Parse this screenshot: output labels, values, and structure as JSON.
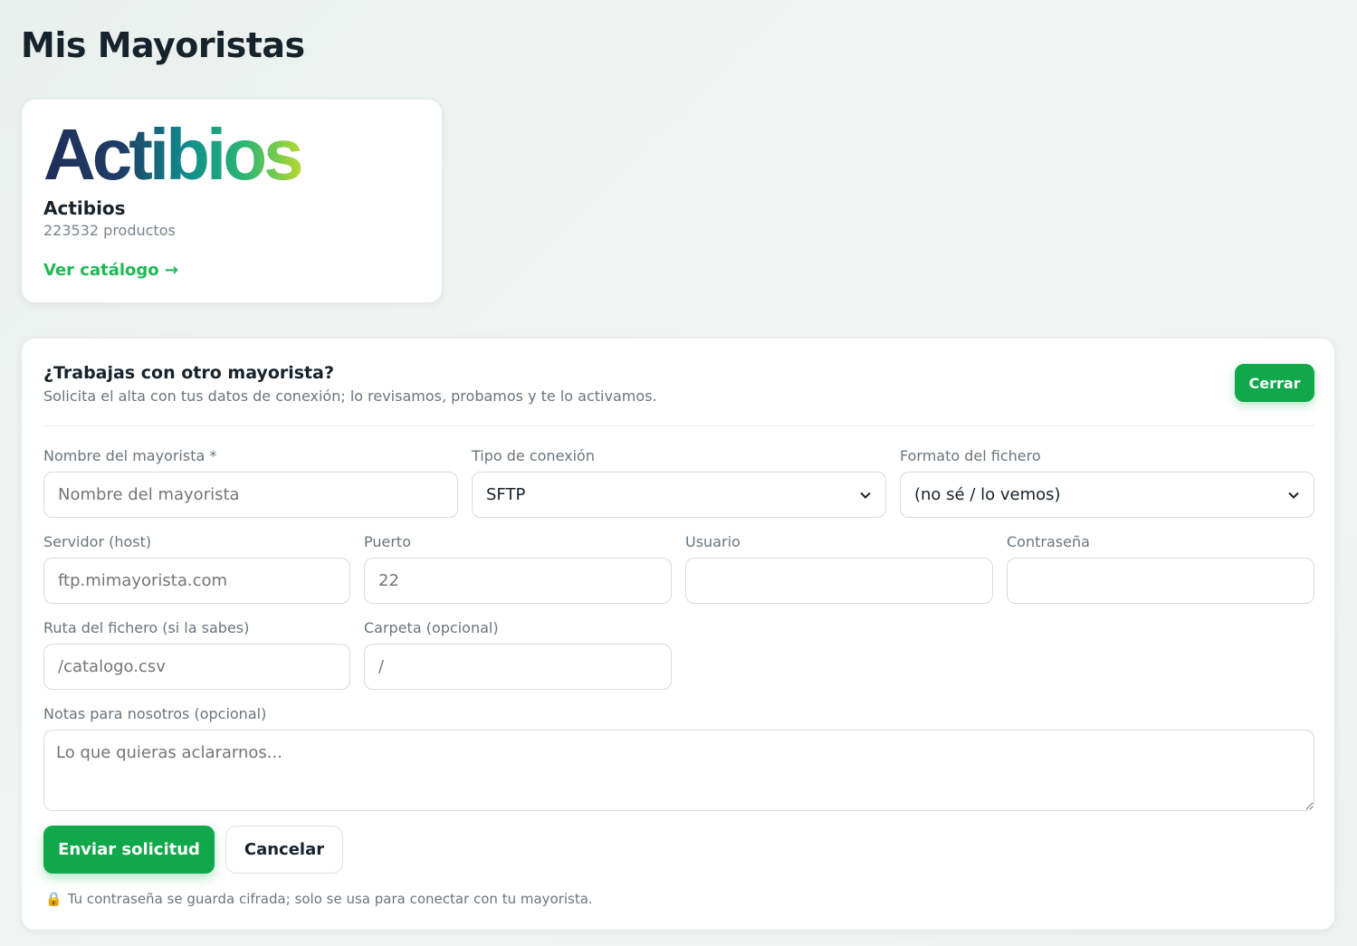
{
  "page": {
    "title": "Mis Mayoristas"
  },
  "vendor": {
    "logo_text": "Actibios",
    "name": "Actibios",
    "count": "223532 productos",
    "link": "Ver catálogo →"
  },
  "request": {
    "title": "¿Trabajas con otro mayorista?",
    "subtitle": "Solicita el alta con tus datos de conexión; lo revisamos, probamos y te lo activamos.",
    "close_label": "Cerrar",
    "fields": {
      "name": {
        "label": "Nombre del mayorista *",
        "placeholder": "Nombre del mayorista"
      },
      "connection": {
        "label": "Tipo de conexión",
        "value": "SFTP"
      },
      "format": {
        "label": "Formato del fichero",
        "value": "(no sé / lo vemos)"
      },
      "host": {
        "label": "Servidor (host)",
        "placeholder": "ftp.mimayorista.com"
      },
      "port": {
        "label": "Puerto",
        "placeholder": "22"
      },
      "user": {
        "label": "Usuario",
        "placeholder": ""
      },
      "password": {
        "label": "Contraseña",
        "placeholder": ""
      },
      "path": {
        "label": "Ruta del fichero (si la sabes)",
        "placeholder": "/catalogo.csv"
      },
      "folder": {
        "label": "Carpeta (opcional)",
        "placeholder": "/"
      },
      "notes": {
        "label": "Notas para nosotros (opcional)",
        "placeholder": "Lo que quieras aclararnos..."
      }
    },
    "send_label": "Enviar solicitud",
    "cancel_label": "Cancelar",
    "footnote": "Tu contraseña se guarda cifrada; solo se usa para conectar con tu mayorista."
  },
  "colors": {
    "accent": "#10a84a",
    "link": "#1db954",
    "logo_dark": "#1f2d5a",
    "logo_light": "#a5d82f"
  },
  "icons": {
    "chevron": "chevron-down-icon",
    "lock": "lock-icon"
  }
}
